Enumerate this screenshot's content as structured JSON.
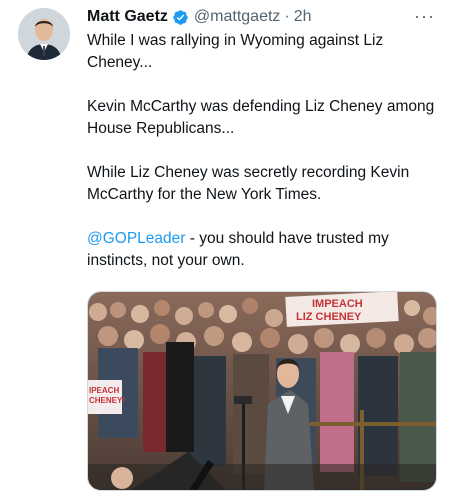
{
  "tweet": {
    "author_name": "Matt Gaetz",
    "handle": "@mattgaetz",
    "separator": "·",
    "time": "2h",
    "more_label": "···",
    "paragraph1": "While I was rallying in Wyoming against Liz Cheney...",
    "paragraph2": "Kevin McCarthy was defending Liz Cheney among House Republicans...",
    "paragraph3": "While Liz Cheney was secretly recording Kevin McCarthy for the New York Times.",
    "mention": "@GOPLeader",
    "paragraph4_rest": " - you should have trusted my instincts, not your own."
  },
  "media": {
    "sign_top_line1": "IMPEACH",
    "sign_top_line2": "LIZ CHENEY",
    "sign_left_line1": "IPEACH",
    "sign_left_line2": "CHENEY!"
  },
  "colors": {
    "link": "#1d9bf0",
    "verified": "#1d9bf0",
    "secondary_text": "#536471"
  },
  "icons": [
    "verified-badge-icon",
    "more-options-icon"
  ]
}
